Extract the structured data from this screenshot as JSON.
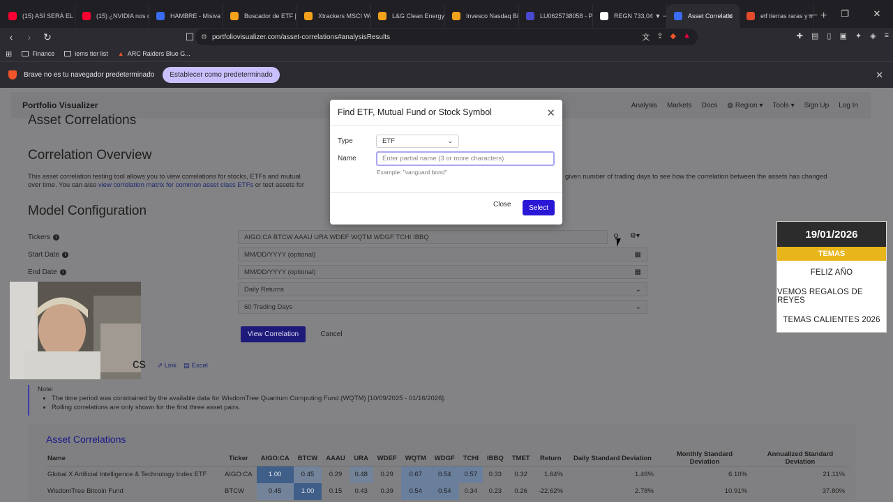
{
  "tabs": [
    {
      "label": "(15) ASÍ SERÁ EL MU",
      "color": "#ff0033"
    },
    {
      "label": "(15) ¿NVIDIA nos de",
      "color": "#ff0033"
    },
    {
      "label": "HAMBRE - Misiva V",
      "color": "#3a6cf0"
    },
    {
      "label": "Buscador de ETF | ju",
      "color": "#f2a11b"
    },
    {
      "label": "Xtrackers MSCI Wor",
      "color": "#f2a11b"
    },
    {
      "label": "L&G Clean Energy U",
      "color": "#f2a11b"
    },
    {
      "label": "Invesco Nasdaq Bio",
      "color": "#f2a11b"
    },
    {
      "label": "LU0625738058 - Pic",
      "color": "#4a4ad0"
    },
    {
      "label": "REGN 733,04 ▼ −1.",
      "color": "#ffffff"
    },
    {
      "label": "Asset Correlatio",
      "color": "#3b6df5"
    },
    {
      "label": "etf tierras raras y m",
      "color": "#e24a2b"
    }
  ],
  "address": {
    "url": "portfoliovisualizer.com/asset-correlations#analysisResults"
  },
  "bookmarks": [
    "Finance",
    "iems tier list",
    "ARC Raiders Blue G..."
  ],
  "infobar": {
    "text": "Brave no es tu navegador predeterminado",
    "button": "Establecer como predeterminado"
  },
  "nav": {
    "brand": "Portfolio Visualizer",
    "links": [
      "Analysis",
      "Markets",
      "Docs",
      "Region",
      "Tools",
      "Sign Up",
      "Log In"
    ]
  },
  "headings": {
    "top": "Asset Correlations",
    "overview": "Correlation Overview",
    "model": "Model Configuration",
    "results": "cs"
  },
  "description": {
    "part1": "This asset correlation testing tool allows you to view correlations for stocks, ETFs and mutual",
    "link1": "view correlation matrix for common asset class ETFs",
    "part2": "over time. You can also ",
    "part3": " or test assets for",
    "right": "given number of trading days to see how the correlation between the assets has changed"
  },
  "form": {
    "tickers_label": "Tickers",
    "tickers_value": "AIGO:CA BTCW AAAU URA WDEF WQTM WDGF TCHI IBBQ",
    "start_label": "Start Date",
    "start_placeholder": "MM/DD/YYYY (optional)",
    "end_label": "End Date",
    "end_placeholder": "MM/DD/YYYY (optional)",
    "returns_value": "Daily Returns",
    "window_value": "60 Trading Days",
    "view_button": "View Correlation",
    "cancel_button": "Cancel"
  },
  "result_links": {
    "link": "Link",
    "excel": "Excel"
  },
  "note": {
    "title": "Note:",
    "items": [
      "The time period was constrained by the available data for WisdomTree Quantum Computing Fund (WQTM) [10/09/2025 - 01/16/2026].",
      "Rolling correlations are only shown for the first three asset pairs."
    ]
  },
  "table": {
    "title": "Asset Correlations",
    "headers": [
      "Name",
      "Ticker",
      "AIGO:CA",
      "BTCW",
      "AAAU",
      "URA",
      "WDEF",
      "WQTM",
      "WDGF",
      "TCHI",
      "IBBQ",
      "TMET",
      "Return",
      "Daily Standard Deviation",
      "Monthly Standard Deviation",
      "Annualized Standard Deviation"
    ],
    "rows": [
      [
        "Global X Artificial Intelligence & Technology Index ETF",
        "AIGO:CA",
        "1.00",
        "0.45",
        "0.29",
        "0.48",
        "0.29",
        "0.67",
        "0.54",
        "0.57",
        "0.33",
        "0.32",
        "1.64%",
        "1.46%",
        "6.10%",
        "21.11%"
      ],
      [
        "WisdomTree Bitcoin Fund",
        "BTCW",
        "0.45",
        "1.00",
        "0.15",
        "0.43",
        "0.39",
        "0.54",
        "0.54",
        "0.34",
        "0.23",
        "0.26",
        "-22.62%",
        "2.78%",
        "10.91%",
        "37.80%"
      ]
    ]
  },
  "modal": {
    "title": "Find ETF, Mutual Fund or Stock Symbol",
    "type_label": "Type",
    "type_value": "ETF",
    "name_label": "Name",
    "name_placeholder": "Enter partial name (3 or more characters)",
    "example": "Example: \"vanguard bond\"",
    "close_button": "Close",
    "select_button": "Select"
  },
  "overlay": {
    "date": "19/01/2026",
    "header": "TEMAS",
    "items": [
      "FELIZ AÑO",
      "VEMOS REGALOS DE REYES",
      "TEMAS CALIENTES 2026"
    ]
  }
}
